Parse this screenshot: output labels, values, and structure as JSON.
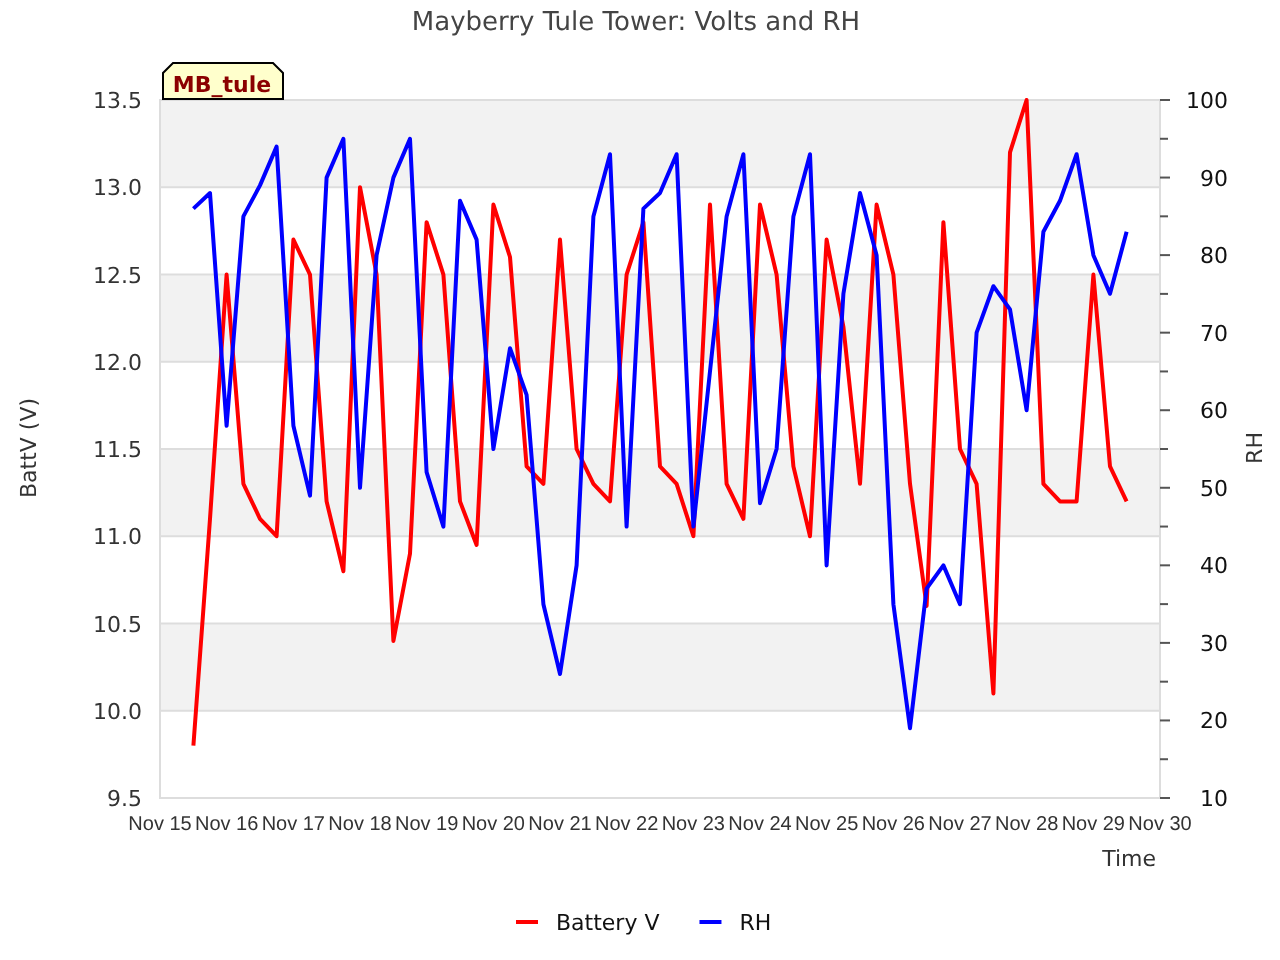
{
  "chart": {
    "site_tag": "MB_tule",
    "chart_data": {
      "type": "line",
      "title": "Mayberry Tule Tower: Volts and RH",
      "xlabel": "Time",
      "ylabel": "BattV (V)",
      "y2label": "RH",
      "ylim": [
        9.5,
        13.5
      ],
      "y2lim": [
        10,
        100
      ],
      "categories": [
        "Nov 15",
        null,
        null,
        null,
        "Nov 16",
        null,
        null,
        null,
        "Nov 17",
        null,
        null,
        null,
        "Nov 18",
        null,
        null,
        null,
        "Nov 19",
        null,
        null,
        null,
        "Nov 20",
        null,
        null,
        null,
        "Nov 21",
        null,
        null,
        null,
        "Nov 22",
        null,
        null,
        null,
        "Nov 23",
        null,
        null,
        null,
        "Nov 24",
        null,
        null,
        null,
        "Nov 25",
        null,
        null,
        null,
        "Nov 26",
        null,
        null,
        null,
        "Nov 27",
        null,
        null,
        null,
        "Nov 28",
        null,
        null,
        null,
        "Nov 29",
        null,
        null,
        null,
        "Nov 30"
      ],
      "yticks": [
        {
          "value": 9.5,
          "label": "9.5"
        },
        {
          "value": 10,
          "label": "10.0"
        },
        {
          "value": 10.5,
          "label": "10.5"
        },
        {
          "value": 11,
          "label": "11.0"
        },
        {
          "value": 11.5,
          "label": "11.5"
        },
        {
          "value": 12,
          "label": "12.0"
        },
        {
          "value": 12.5,
          "label": "12.5"
        },
        {
          "value": 13,
          "label": "13.0"
        },
        {
          "value": 13.5,
          "label": "13.5"
        }
      ],
      "y2ticks": [
        10,
        20,
        30,
        40,
        50,
        60,
        70,
        80,
        90,
        100
      ],
      "grid": true,
      "legend": "bottom",
      "series": [
        {
          "name": "Battery V",
          "color": "#ff0000",
          "values": [
            null,
            null,
            9.8,
            11.1,
            12.5,
            11.3,
            11.1,
            11.0,
            12.7,
            12.5,
            11.2,
            10.8,
            13.0,
            12.5,
            10.4,
            10.9,
            12.8,
            12.5,
            11.2,
            10.95,
            12.9,
            12.6,
            11.4,
            11.3,
            12.7,
            11.5,
            11.3,
            11.2,
            12.5,
            12.8,
            11.4,
            11.3,
            11.0,
            12.9,
            11.3,
            11.1,
            12.9,
            12.5,
            11.4,
            11.0,
            12.7,
            12.2,
            11.3,
            12.9,
            12.5,
            11.3,
            10.6,
            12.8,
            11.5,
            11.3,
            10.1,
            13.2,
            13.5,
            11.3,
            11.2,
            11.2,
            12.5,
            11.4,
            11.2,
            null,
            null
          ]
        },
        {
          "name": "RH",
          "color": "#0000ff",
          "axis": "y2",
          "values": [
            null,
            null,
            86,
            88,
            58,
            85,
            89,
            94,
            58,
            49,
            90,
            95,
            50,
            80,
            90,
            95,
            52,
            45,
            87,
            82,
            55,
            68,
            62,
            35,
            26,
            40,
            85,
            93,
            45,
            86,
            88,
            93,
            45,
            65,
            85,
            93,
            48,
            55,
            85,
            93,
            40,
            75,
            88,
            80,
            35,
            19,
            37,
            40,
            35,
            70,
            76,
            73,
            60,
            83,
            87,
            93,
            80,
            75,
            83,
            null,
            null
          ]
        }
      ]
    }
  }
}
